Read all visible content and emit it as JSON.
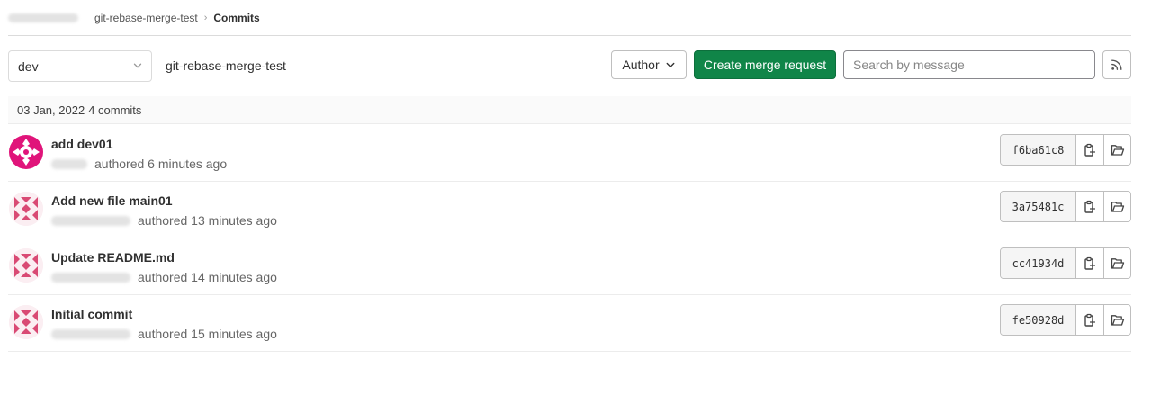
{
  "breadcrumb": {
    "project": "git-rebase-merge-test",
    "current": "Commits"
  },
  "toolbar": {
    "branch": "dev",
    "project_path": "git-rebase-merge-test",
    "author_label": "Author",
    "create_mr_label": "Create merge request",
    "search_placeholder": "Search by message"
  },
  "day": {
    "date": "03 Jan, 2022",
    "count": "4 commits"
  },
  "commits": [
    {
      "title": "add dev01",
      "meta": "authored 6 minutes ago",
      "sha": "f6ba61c8"
    },
    {
      "title": "Add new file main01",
      "meta": "authored 13 minutes ago",
      "sha": "3a75481c"
    },
    {
      "title": "Update README.md",
      "meta": "authored 14 minutes ago",
      "sha": "cc41934d"
    },
    {
      "title": "Initial commit",
      "meta": "authored 15 minutes ago",
      "sha": "fe50928d"
    }
  ],
  "colors": {
    "primary_green": "#108548",
    "avatar_magenta": "#e0147a",
    "avatar_pink": "#d94a74"
  }
}
